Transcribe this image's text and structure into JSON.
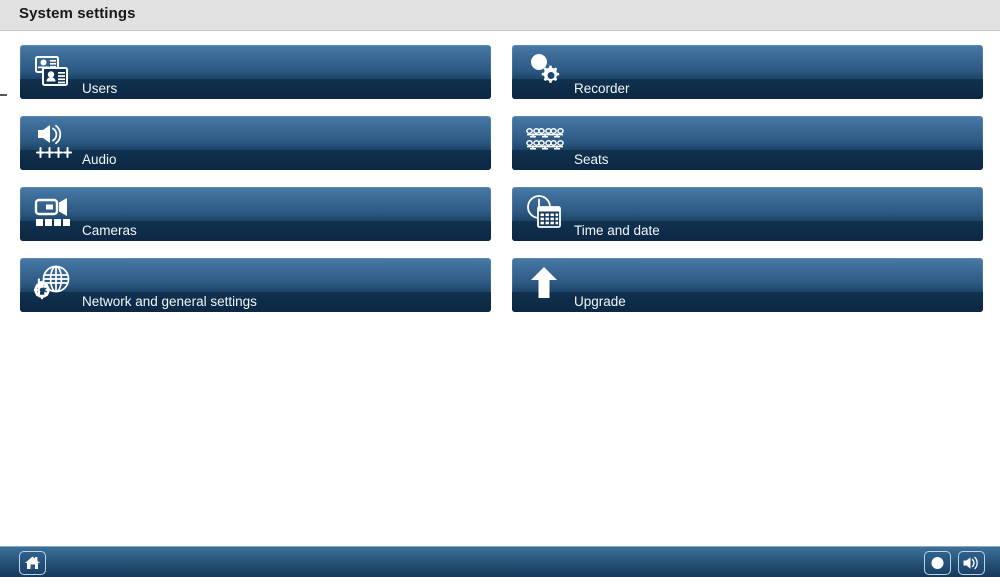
{
  "header": {
    "title": "System settings"
  },
  "tiles": [
    {
      "id": "users",
      "label": "Users",
      "icon": "id-cards-icon",
      "column": "left",
      "row": 1
    },
    {
      "id": "audio",
      "label": "Audio",
      "icon": "speaker-faders-icon",
      "column": "left",
      "row": 2
    },
    {
      "id": "cameras",
      "label": "Cameras",
      "icon": "video-camera-icon",
      "column": "left",
      "row": 3
    },
    {
      "id": "network",
      "label": "Network and general settings",
      "icon": "globe-gear-icon",
      "column": "left",
      "row": 4
    },
    {
      "id": "recorder",
      "label": "Recorder",
      "icon": "record-gear-icon",
      "column": "right",
      "row": 1
    },
    {
      "id": "seats",
      "label": "Seats",
      "icon": "seats-grid-icon",
      "column": "right",
      "row": 2
    },
    {
      "id": "timedate",
      "label": "Time and date",
      "icon": "clock-calendar-icon",
      "column": "right",
      "row": 3
    },
    {
      "id": "upgrade",
      "label": "Upgrade",
      "icon": "arrow-up-icon",
      "column": "right",
      "row": 4
    }
  ],
  "bottom_bar": {
    "home_icon": "home-icon",
    "record_icon": "record-circle-icon",
    "volume_icon": "speaker-volume-icon"
  },
  "colors": {
    "header_background": "#e1e1e1",
    "tile_top": "#4a7ca8",
    "tile_bottom": "#0f2c4a",
    "tile_label_band": "#0b2743",
    "bar_top": "#3d7099",
    "bar_bottom": "#16395a",
    "page_background": "#ffffff"
  }
}
